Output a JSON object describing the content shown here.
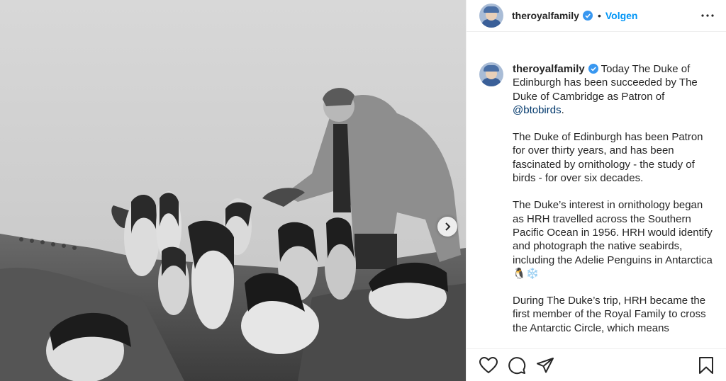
{
  "post": {
    "username": "theroyalfamily",
    "dot": "•",
    "follow_label": "Volgen",
    "more_icon": "more-horizontal-icon",
    "verified_color": "#3897f0",
    "accent_color": "#0095f6"
  },
  "caption": {
    "username": "theroyalfamily",
    "p1_text": " Today The Duke of Edinburgh has been succeeded by The Duke of Cambridge as Patron of ",
    "mention": "@btobirds",
    "p1_end": ".",
    "p2": "The Duke of Edinburgh has been Patron for over thirty years, and has been fascinated by ornithology - the study of birds - for over six decades.",
    "p3": "The Duke’s interest in ornithology began as HRH travelled across the Southern Pacific Ocean in 1956. HRH would identify and photograph the native seabirds, including the Adelie Penguins in Antarctica 🐧❄️",
    "p4": "During The Duke’s trip, HRH became the first member of the Royal Family to cross the Antarctic Circle, which means"
  },
  "actions": {
    "icons": [
      "heart-icon",
      "comment-icon",
      "share-icon",
      "bookmark-icon"
    ]
  }
}
